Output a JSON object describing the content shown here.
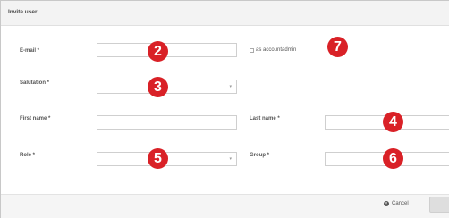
{
  "dialog": {
    "title": "Invite user"
  },
  "form": {
    "email_label": "E-mail *",
    "as_admin_label": "as accountadmin",
    "salutation_label": "Salutation *",
    "first_name_label": "First name *",
    "last_name_label": "Last name *",
    "role_label": "Role *",
    "group_label": "Group *",
    "select_caret": "▾"
  },
  "badges": {
    "email": "2",
    "salutation": "3",
    "last_name": "4",
    "role": "5",
    "group": "6",
    "admin": "7"
  },
  "footer": {
    "cancel_label": "Cancel",
    "cancel_icon": "×"
  },
  "colors": {
    "badge": "#d92127",
    "header_bg": "#f3f3f3",
    "border": "#cfcfcf"
  }
}
